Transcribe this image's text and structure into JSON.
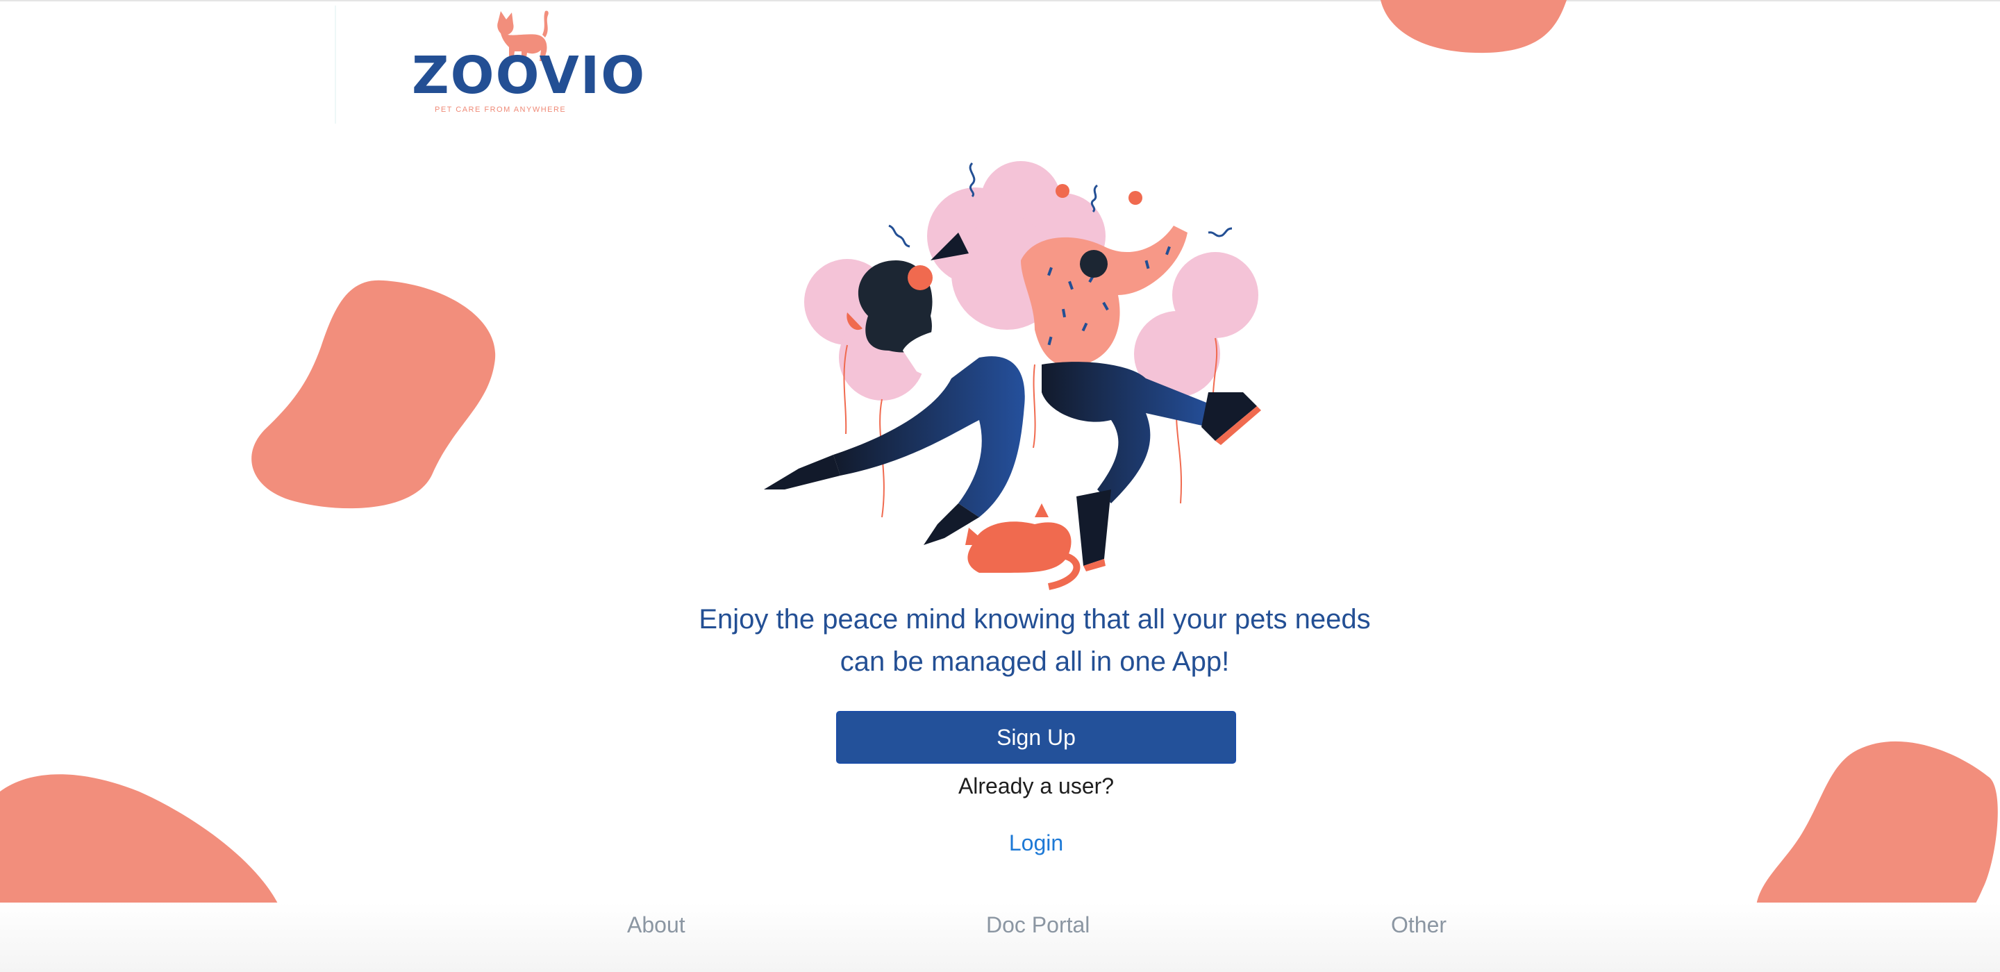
{
  "brand": {
    "name": "ZOOVIO",
    "tagline": "PET CARE FROM ANYWHERE",
    "primary_color": "#23519a",
    "accent_color": "#f28e7c"
  },
  "hero": {
    "illustration": "people-celebrating-with-balloons-and-cat",
    "message_line1": "Enjoy the peace mind knowing that all your pets needs",
    "message_line2": "can be managed all in one App!"
  },
  "auth": {
    "signup_label": "Sign Up",
    "already_user_text": "Already a user?",
    "login_label": "Login"
  },
  "footer": {
    "links": [
      {
        "label": "About"
      },
      {
        "label": "Doc Portal"
      },
      {
        "label": "Other"
      }
    ]
  }
}
